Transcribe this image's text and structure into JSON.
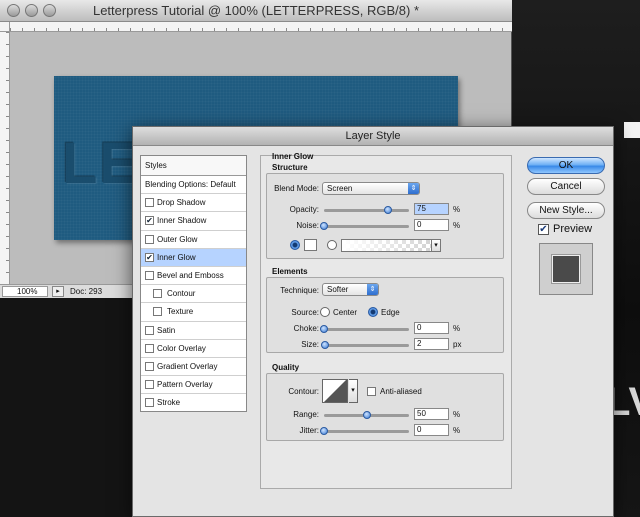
{
  "colors": {
    "canvas": "#1f5b80",
    "selection": "#b6d3ff",
    "accent": "#3a8ae8"
  },
  "doc": {
    "title": "Letterpress Tutorial @ 100% (LETTERPRESS, RGB/8) *",
    "canvas_text": "LETTE",
    "zoom": "100%",
    "status": "Doc: 293"
  },
  "background": {
    "letters": "LV"
  },
  "dialog": {
    "title": "Layer Style",
    "styles_header": "Styles",
    "styles": [
      {
        "label": "Blending Options: Default",
        "checked": ""
      },
      {
        "label": "Drop Shadow",
        "checked": ""
      },
      {
        "label": "Inner Shadow",
        "checked": "✔"
      },
      {
        "label": "Outer Glow",
        "checked": ""
      },
      {
        "label": "Inner Glow",
        "checked": "✔"
      },
      {
        "label": "Bevel and Emboss",
        "checked": ""
      },
      {
        "label": "Contour",
        "checked": ""
      },
      {
        "label": "Texture",
        "checked": ""
      },
      {
        "label": "Satin",
        "checked": ""
      },
      {
        "label": "Color Overlay",
        "checked": ""
      },
      {
        "label": "Gradient Overlay",
        "checked": ""
      },
      {
        "label": "Pattern Overlay",
        "checked": ""
      },
      {
        "label": "Stroke",
        "checked": ""
      }
    ],
    "section": "Inner Glow",
    "structure": {
      "title": "Structure",
      "blend_mode_label": "Blend Mode:",
      "blend_mode": "Screen",
      "opacity_label": "Opacity:",
      "opacity": "75",
      "opacity_pct": 75,
      "noise_label": "Noise:",
      "noise": "0",
      "noise_pct": 0,
      "unit": "%"
    },
    "elements": {
      "title": "Elements",
      "technique_label": "Technique:",
      "technique": "Softer",
      "source_label": "Source:",
      "source_center": "Center",
      "source_edge": "Edge",
      "choke_label": "Choke:",
      "choke": "0",
      "choke_pct": 0,
      "size_label": "Size:",
      "size": "2",
      "size_pct": 1,
      "unit_pct": "%",
      "unit_px": "px"
    },
    "quality": {
      "title": "Quality",
      "contour_label": "Contour:",
      "anti_aliased": "Anti-aliased",
      "range_label": "Range:",
      "range": "50",
      "range_pct": 50,
      "jitter_label": "Jitter:",
      "jitter": "0",
      "jitter_pct": 0,
      "unit": "%"
    },
    "buttons": {
      "ok": "OK",
      "cancel": "Cancel",
      "new_style": "New Style...",
      "preview": "Preview",
      "preview_checked": "✔"
    }
  }
}
